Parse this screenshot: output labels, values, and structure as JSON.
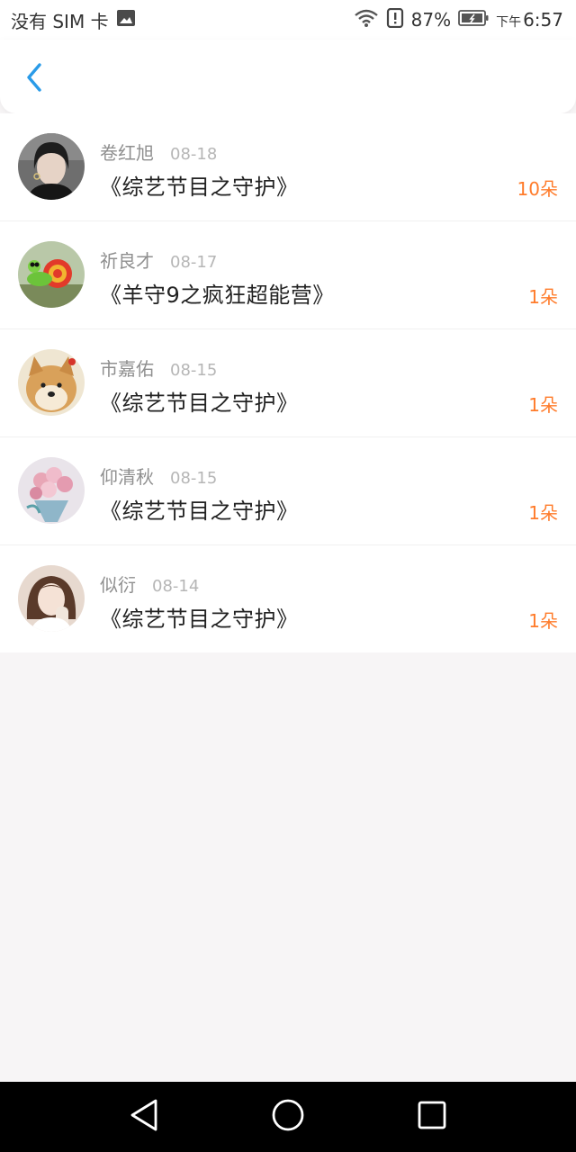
{
  "status_bar": {
    "carrier": "没有 SIM 卡",
    "battery_percent": "87%",
    "time_prefix": "下午",
    "time": "6:57",
    "icons": [
      "image-icon",
      "wifi-icon",
      "alert-icon",
      "battery-icon"
    ]
  },
  "header": {
    "back_icon": "chevron-left-icon",
    "accent": "#2a9be8"
  },
  "records": [
    {
      "name": "卷红旭",
      "date": "08-18",
      "title": "《综艺节目之守护》",
      "count": "10朵"
    },
    {
      "name": "祈良才",
      "date": "08-17",
      "title": "《羊守9之疯狂超能营》",
      "count": "1朵"
    },
    {
      "name": "市嘉佑",
      "date": "08-15",
      "title": "《综艺节目之守护》",
      "count": "1朵"
    },
    {
      "name": "仰清秋",
      "date": "08-15",
      "title": "《综艺节目之守护》",
      "count": "1朵"
    },
    {
      "name": "似衍",
      "date": "08-14",
      "title": "《综艺节目之守护》",
      "count": "1朵"
    }
  ],
  "colors": {
    "count": "#ff7b2a",
    "name": "#8f8f8f",
    "date": "#b6b6b6",
    "background": "#f7f5f6",
    "nav_bar": "#000000"
  },
  "nav_bar": {
    "icons": [
      "back-triangle-icon",
      "home-circle-icon",
      "recent-square-icon"
    ]
  }
}
